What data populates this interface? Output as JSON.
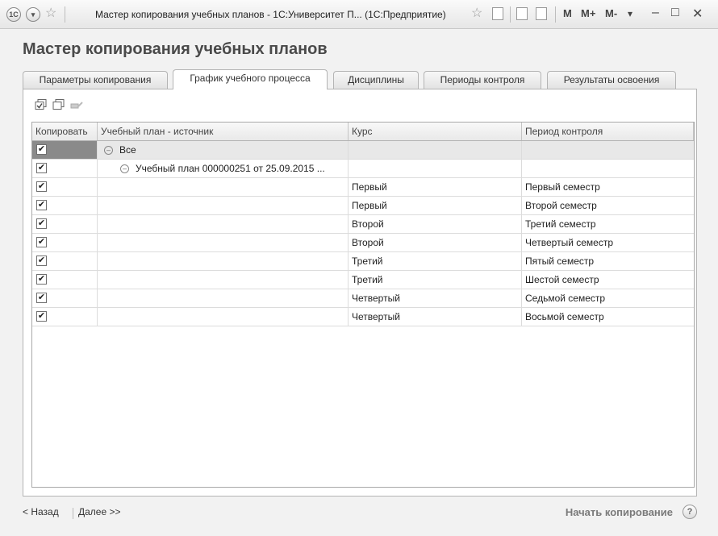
{
  "window": {
    "logo_text": "1C",
    "title": "Мастер копирования учебных планов - 1С:Университет П...  (1С:Предприятие)",
    "m_buttons": [
      "M",
      "M+",
      "M-"
    ]
  },
  "form": {
    "title": "Мастер копирования учебных планов"
  },
  "tabs": [
    {
      "label": "Параметры копирования"
    },
    {
      "label": "График учебного процесса"
    },
    {
      "label": "Дисциплины"
    },
    {
      "label": "Периоды контроля"
    },
    {
      "label": "Результаты освоения"
    }
  ],
  "table": {
    "columns": [
      "Копировать",
      "Учебный план - источник",
      "Курс",
      "Период контроля"
    ],
    "group_row": {
      "checked": true,
      "label": "Все"
    },
    "plan_row": {
      "checked": true,
      "label": "Учебный план 000000251 от 25.09.2015 ..."
    },
    "rows": [
      {
        "checked": true,
        "course": "Первый",
        "period": "Первый семестр"
      },
      {
        "checked": true,
        "course": "Первый",
        "period": "Второй семестр"
      },
      {
        "checked": true,
        "course": "Второй",
        "period": "Третий семестр"
      },
      {
        "checked": true,
        "course": "Второй",
        "period": "Четвертый семестр"
      },
      {
        "checked": true,
        "course": "Третий",
        "period": "Пятый семестр"
      },
      {
        "checked": true,
        "course": "Третий",
        "period": "Шестой семестр"
      },
      {
        "checked": true,
        "course": "Четвертый",
        "period": "Седьмой семестр"
      },
      {
        "checked": true,
        "course": "Четвертый",
        "period": "Восьмой семестр"
      }
    ]
  },
  "footer": {
    "back": "< Назад",
    "next": "Далее >>",
    "start": "Начать копирование",
    "help": "?"
  }
}
